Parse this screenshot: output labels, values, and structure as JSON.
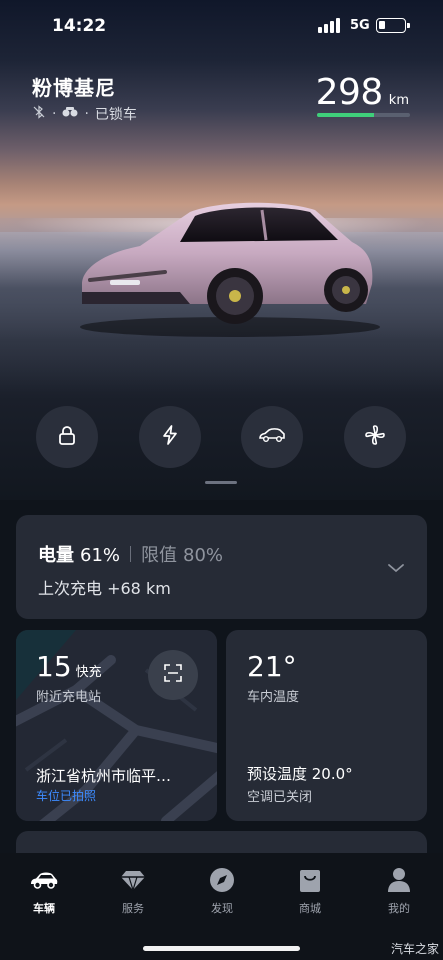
{
  "status_bar": {
    "time": "14:22",
    "network": "5G",
    "battery_level": 0.25
  },
  "vehicle": {
    "name": "粉博基尼",
    "lock_status": "已锁车",
    "range_value": "298",
    "range_unit": "km",
    "range_fraction": 0.61
  },
  "controls": [
    {
      "icon": "lock-icon"
    },
    {
      "icon": "lightning-icon"
    },
    {
      "icon": "car-trunk-icon"
    },
    {
      "icon": "fan-icon"
    }
  ],
  "battery_card": {
    "label": "电量",
    "value": "61%",
    "limit_label": "限值",
    "limit_value": "80%",
    "last_charge": "上次充电 +68 km"
  },
  "station_card": {
    "count": "15",
    "type": "快充",
    "subtitle": "附近充电站",
    "address": "浙江省杭州市临平…",
    "link": "车位已拍照"
  },
  "temp_card": {
    "cabin_temp": "21°",
    "cabin_label": "车内温度",
    "preset": "预设温度 20.0°",
    "ac_status": "空调已关闭"
  },
  "bottom_nav": {
    "items": [
      {
        "label": "车辆",
        "icon": "car-icon",
        "active": true
      },
      {
        "label": "服务",
        "icon": "diamond-icon",
        "active": false
      },
      {
        "label": "发现",
        "icon": "compass-icon",
        "active": false
      },
      {
        "label": "商城",
        "icon": "shopping-bag-icon",
        "active": false
      },
      {
        "label": "我的",
        "icon": "person-icon",
        "active": false
      }
    ]
  },
  "watermark": "汽车之家",
  "colors": {
    "accent_green": "#3fcf7a",
    "link_blue": "#3d8bff",
    "card_bg": "#262b36"
  }
}
